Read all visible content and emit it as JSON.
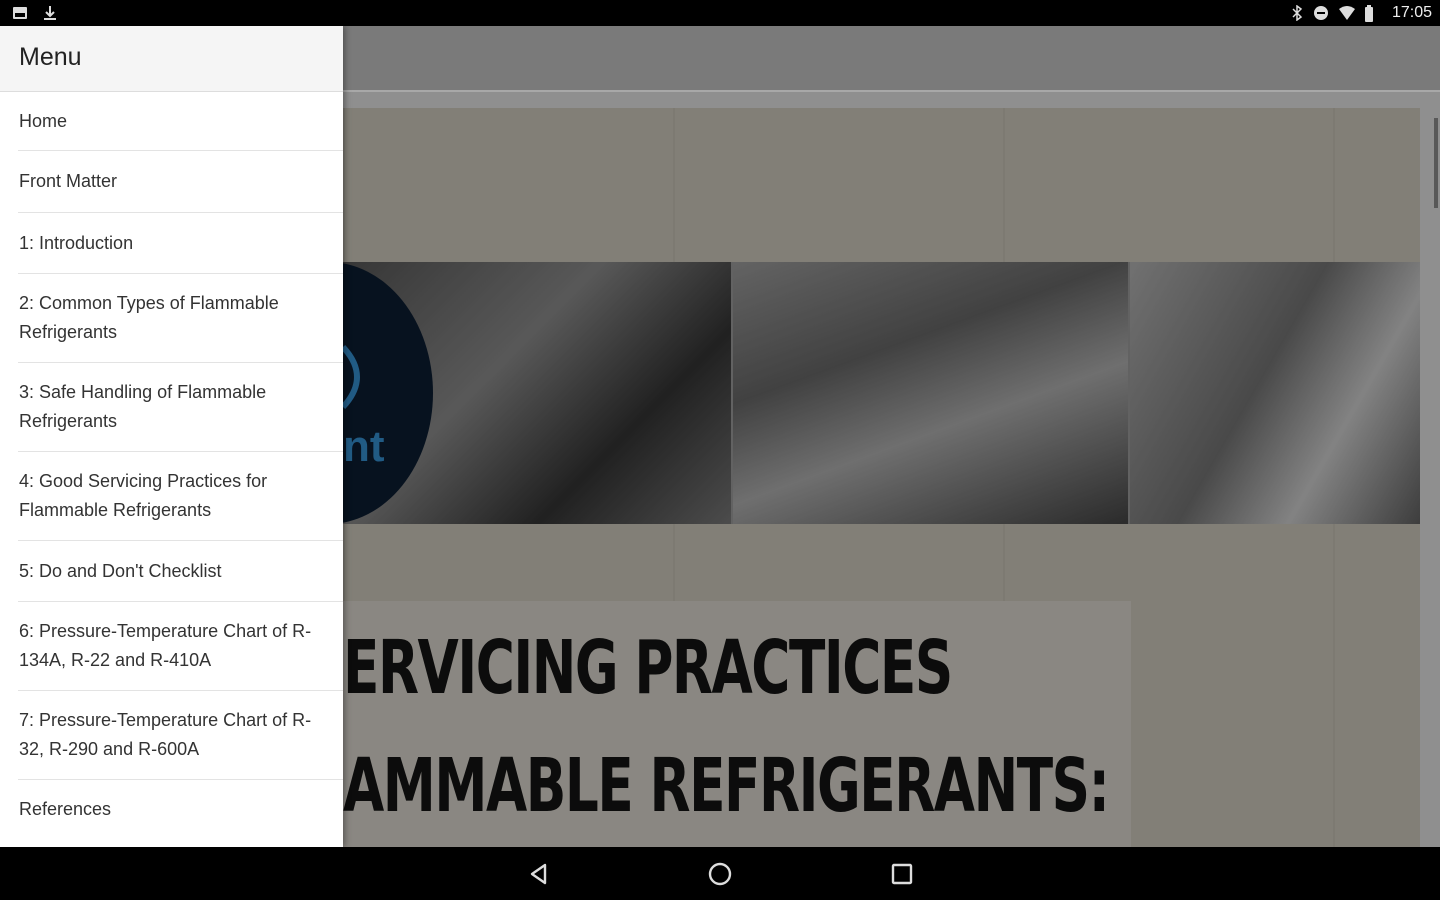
{
  "status_bar": {
    "time": "17:05",
    "left_icons": [
      "gallery-icon",
      "download-icon"
    ],
    "right_icons": [
      "bluetooth-icon",
      "do-not-disturb-icon",
      "wifi-icon",
      "battery-icon"
    ]
  },
  "drawer": {
    "title": "Menu",
    "items": [
      {
        "label": "Home"
      },
      {
        "label": "Front Matter"
      },
      {
        "label": "1: Introduction"
      },
      {
        "label": "2: Common Types of Flammable Refrigerants"
      },
      {
        "label": "3: Safe Handling of Flammable Refrigerants"
      },
      {
        "label": "4: Good Servicing Practices for Flammable Refrigerants"
      },
      {
        "label": "5: Do and Don't Checklist"
      },
      {
        "label": "6: Pressure-Temperature Chart of R-134A, R-22 and R-410A"
      },
      {
        "label": "7: Pressure-Temperature Chart of R-32, R-290 and R-600A"
      },
      {
        "label": "References"
      }
    ]
  },
  "cover": {
    "logo_fragment": "nt",
    "title_line_1": "ERVICING PRACTICES",
    "title_line_2": "AMMABLE REFRIGERANTS:"
  },
  "nav_bar": {
    "buttons": [
      "back-icon",
      "home-icon",
      "recents-icon"
    ]
  },
  "colors": {
    "drawer_bg": "#ffffff",
    "scrim": "rgba(0,0,0,0.28)",
    "un_blue": "#2e7eb8"
  }
}
